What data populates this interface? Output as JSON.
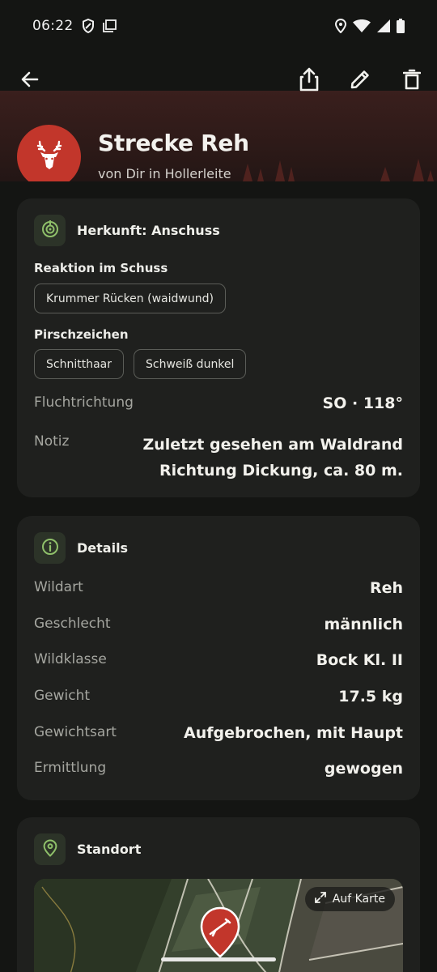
{
  "status_bar": {
    "time": "06:22"
  },
  "header": {
    "title": "Strecke Reh",
    "subtitle": "von Dir in Hollerleite",
    "avatar_icon": "deer-head-icon",
    "accent_color": "#c2362b"
  },
  "toolbar": {
    "back_icon": "arrow-left-icon",
    "share_icon": "share-icon",
    "edit_icon": "pencil-icon",
    "delete_icon": "trash-icon"
  },
  "origin_card": {
    "title": "Herkunft: Anschuss",
    "reaction_label": "Reaktion im Schuss",
    "reaction_chips": [
      "Krummer Rücken (waidwund)"
    ],
    "signs_label": "Pirschzeichen",
    "signs_chips": [
      "Schnitthaar",
      "Schweiß dunkel"
    ],
    "flight_label": "Fluchtrichtung",
    "flight_value": "SO · 118°",
    "note_label": "Notiz",
    "note_line1": "Zuletzt gesehen am Waldrand",
    "note_line2": "Richtung Dickung, ca. 80 m."
  },
  "details_card": {
    "title": "Details",
    "rows": [
      {
        "label": "Wildart",
        "value": "Reh"
      },
      {
        "label": "Geschlecht",
        "value": "männlich"
      },
      {
        "label": "Wildklasse",
        "value": "Bock Kl. II"
      },
      {
        "label": "Gewicht",
        "value": "17.5 kg"
      },
      {
        "label": "Gewichtsart",
        "value": "Aufgebrochen, mit Haupt"
      },
      {
        "label": "Ermittlung",
        "value": "gewogen"
      }
    ]
  },
  "location_card": {
    "title": "Standort",
    "map_button": "Auf Karte"
  }
}
